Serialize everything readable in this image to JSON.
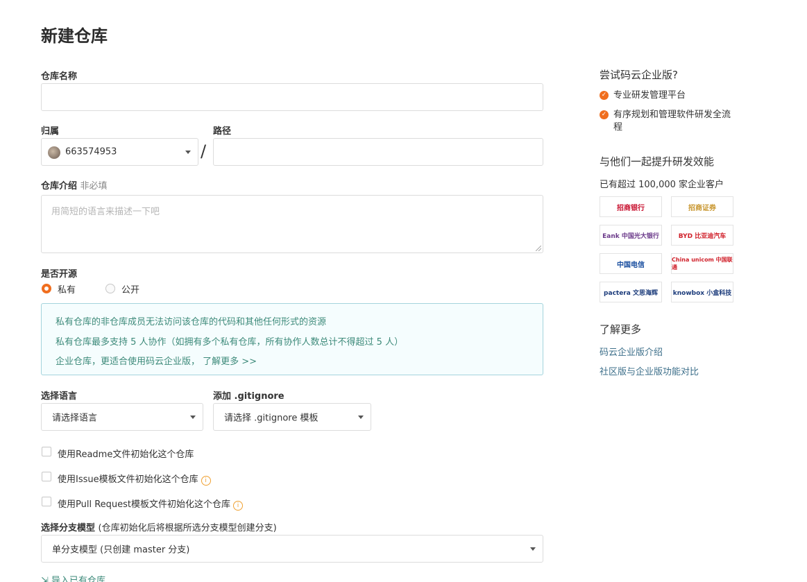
{
  "page": {
    "title": "新建仓库"
  },
  "repo_name": {
    "label": "仓库名称",
    "value": ""
  },
  "owner": {
    "label": "归属",
    "value": "663574953"
  },
  "path": {
    "label": "路径",
    "value": ""
  },
  "description": {
    "label": "仓库介绍",
    "optional": "非必填",
    "placeholder": "用简短的语言来描述一下吧"
  },
  "visibility": {
    "label": "是否开源",
    "options": [
      {
        "label": "私有",
        "selected": true
      },
      {
        "label": "公开",
        "selected": false
      }
    ],
    "notice": [
      "私有仓库的非仓库成员无法访问该仓库的代码和其他任何形式的资源",
      "私有仓库最多支持 5 人协作（如拥有多个私有仓库，所有协作人数总计不得超过 5 人）",
      "企业仓库，更适合使用码云企业版，",
      "了解更多 >>"
    ]
  },
  "language": {
    "label": "选择语言",
    "value": "请选择语言"
  },
  "gitignore": {
    "label": "添加 .gitignore",
    "value": "请选择 .gitignore 模板"
  },
  "init_options": [
    {
      "label": "使用Readme文件初始化这个仓库",
      "info": false
    },
    {
      "label": "使用Issue模板文件初始化这个仓库",
      "info": true
    },
    {
      "label": "使用Pull Request模板文件初始化这个仓库",
      "info": true
    }
  ],
  "branch_model": {
    "label": "选择分支模型",
    "hint": "(仓库初始化后将根据所选分支模型创建分支)",
    "value": "单分支模型 (只创建 master 分支)"
  },
  "import_link": "导入已有仓库",
  "sidebar": {
    "try_title": "尝试码云企业版?",
    "features": [
      "专业研发管理平台",
      "有序规划和管理软件研发全流程"
    ],
    "together_title": "与他们一起提升研发效能",
    "customers": "已有超过 100,000 家企业客户",
    "logos": [
      {
        "name": "招商银行",
        "color": "#c8102e"
      },
      {
        "name": "招商证券",
        "color": "#c8962e"
      },
      {
        "name": "Eank 中国光大银行",
        "color": "#6b3a8a"
      },
      {
        "name": "BYD 比亚迪汽车",
        "color": "#d0202a"
      },
      {
        "name": "中国电信",
        "color": "#1a4fa0"
      },
      {
        "name": "China unicom 中国联通",
        "color": "#d0202a"
      },
      {
        "name": "pactera 文思海辉",
        "color": "#1a3a7a"
      },
      {
        "name": "knowbox 小盒科技",
        "color": "#1a3a7a"
      }
    ],
    "learn_title": "了解更多",
    "links": [
      "码云企业版介绍",
      "社区版与企业版功能对比"
    ]
  }
}
